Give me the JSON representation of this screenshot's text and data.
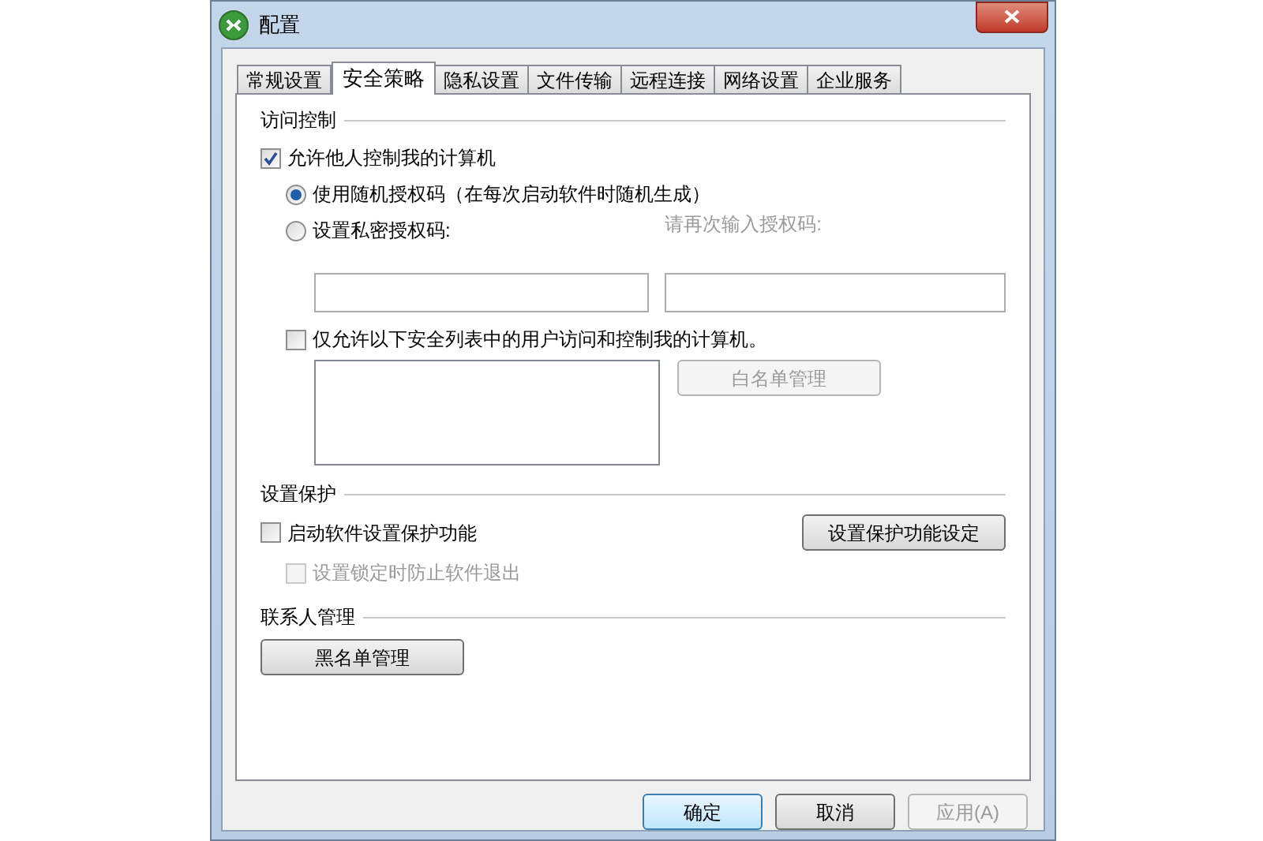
{
  "window": {
    "title": "配置"
  },
  "tabs": [
    {
      "label": "常规设置",
      "selected": false
    },
    {
      "label": "安全策略",
      "selected": true
    },
    {
      "label": "隐私设置",
      "selected": false
    },
    {
      "label": "文件传输",
      "selected": false
    },
    {
      "label": "远程连接",
      "selected": false
    },
    {
      "label": "网络设置",
      "selected": false
    },
    {
      "label": "企业服务",
      "selected": false
    }
  ],
  "access_control": {
    "title": "访问控制",
    "allow_control": {
      "label": "允许他人控制我的计算机",
      "checked": true
    },
    "radios": [
      {
        "label": "使用随机授权码（在每次启动软件时随机生成）",
        "selected": true
      },
      {
        "label": "设置私密授权码:",
        "selected": false
      }
    ],
    "confirm_label": {
      "label": "请再次输入授权码:",
      "disabled": true
    },
    "whitelist_only": {
      "label": "仅允许以下安全列表中的用户访问和控制我的计算机。",
      "checked": false
    },
    "whitelist_button": {
      "label": "白名单管理",
      "disabled": true
    }
  },
  "protection": {
    "title": "设置保护",
    "enable": {
      "label": "启动软件设置保护功能",
      "checked": false,
      "disabled": false
    },
    "lock_exit": {
      "label": "设置锁定时防止软件退出",
      "checked": false,
      "disabled": true
    },
    "settings_button": {
      "label": "设置保护功能设定",
      "disabled": false
    }
  },
  "contacts": {
    "title": "联系人管理",
    "blacklist_button": {
      "label": "黑名单管理",
      "disabled": false
    }
  },
  "footer_buttons": [
    {
      "label": "确定",
      "default": true,
      "disabled": false
    },
    {
      "label": "取消",
      "default": false,
      "disabled": false
    },
    {
      "label": "应用(A)",
      "default": false,
      "disabled": true
    }
  ]
}
